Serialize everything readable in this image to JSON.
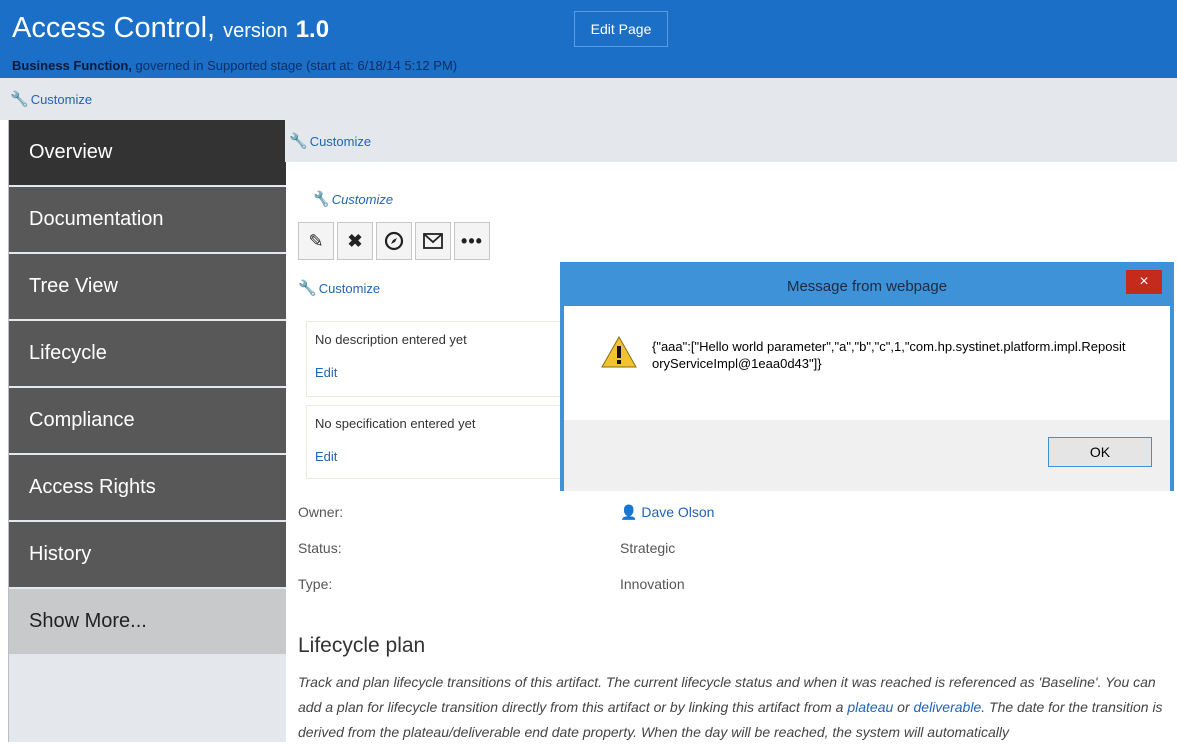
{
  "header": {
    "title": "Access Control,",
    "version_label": "version",
    "version_number": "1.0",
    "subtitle_bold": "Business Function,",
    "subtitle_rest": " governed in Supported stage (start at: 6/18/14 5:12 PM)",
    "edit_page_label": "Edit Page"
  },
  "customize_label": "Customize",
  "sidebar": {
    "items": [
      {
        "label": "Overview"
      },
      {
        "label": "Documentation"
      },
      {
        "label": "Tree View"
      },
      {
        "label": "Lifecycle"
      },
      {
        "label": "Compliance"
      },
      {
        "label": "Access Rights"
      },
      {
        "label": "History"
      },
      {
        "label": "Show More..."
      }
    ]
  },
  "toolbar": {
    "icons": [
      "pencil-icon",
      "delete-icon",
      "compass-icon",
      "envelope-icon",
      "more-icon"
    ]
  },
  "boxes": {
    "description": {
      "text": "No description entered yet",
      "edit": "Edit"
    },
    "specification": {
      "text": "No specification entered yet",
      "edit": "Edit"
    }
  },
  "properties": {
    "owner": {
      "label": "Owner:",
      "value": "Dave Olson"
    },
    "status": {
      "label": "Status:",
      "value": "Strategic"
    },
    "type": {
      "label": "Type:",
      "value": "Innovation"
    }
  },
  "lifecycle": {
    "title": "Lifecycle plan",
    "text_1": "Track and plan lifecycle transitions of this artifact. The current lifecycle status and when it was reached is referenced as 'Baseline'. You can add a plan for lifecycle transition directly from this artifact or by linking this artifact from a ",
    "link_plateau": "plateau",
    "text_or": " or ",
    "link_deliverable": "deliverable",
    "text_2": ". The date for the transition is derived from the plateau/deliverable end date property. When the day will be reached, the system will automatically"
  },
  "dialog": {
    "title": "Message from webpage",
    "close": "×",
    "message": "{\"aaa\":[\"Hello world parameter\",\"a\",\"b\",\"c\",1,\"com.hp.systinet.platform.impl.RepositoryServiceImpl@1eaa0d43\"]}",
    "ok_label": "OK"
  },
  "colors": {
    "header_blue": "#1b6fc6",
    "dialog_border": "#3d92d8",
    "link": "#2064b8",
    "close_red": "#c42b1c"
  }
}
